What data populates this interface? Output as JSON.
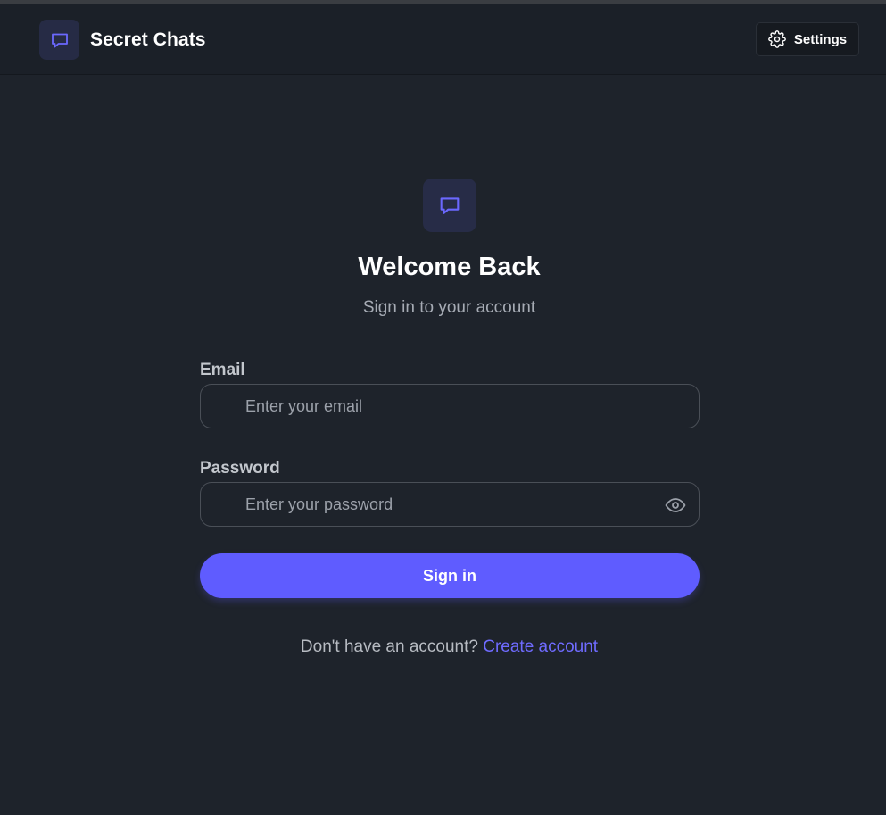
{
  "header": {
    "brand_name": "Secret Chats",
    "settings_label": "Settings"
  },
  "icons": {
    "brand": "chat-bubble-icon",
    "hero": "chat-bubble-icon",
    "settings": "gear-icon",
    "password_toggle": "eye-icon"
  },
  "login": {
    "title": "Welcome Back",
    "subtitle": "Sign in to your account",
    "email": {
      "label": "Email",
      "placeholder": "Enter your email",
      "value": ""
    },
    "password": {
      "label": "Password",
      "placeholder": "Enter your password",
      "value": ""
    },
    "submit_label": "Sign in",
    "footer_text": "Don't have an account?",
    "footer_link": "Create account"
  },
  "colors": {
    "accent": "#5f5cff",
    "background": "#1e232b",
    "header_background": "#1b2028",
    "icon_tile": "#272c47"
  }
}
